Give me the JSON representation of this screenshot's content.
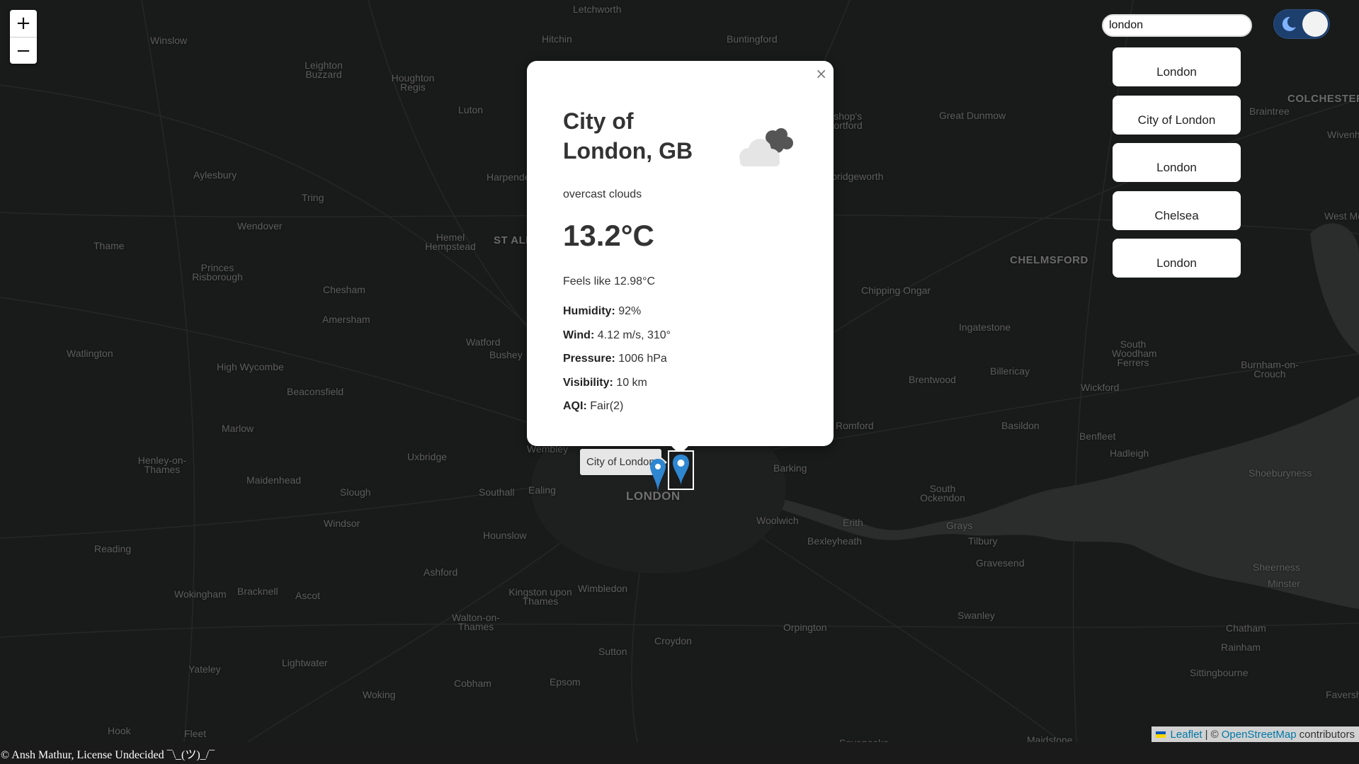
{
  "map": {
    "places": [
      {
        "name": "Letchworth"
      },
      {
        "name": "Winslow"
      },
      {
        "name": "Hitchin"
      },
      {
        "name": "Buntingford"
      },
      {
        "name": "Leighton Buzzard"
      },
      {
        "name": "Houghton Regis"
      },
      {
        "name": "Luton"
      },
      {
        "name": "Bishop's Stortford"
      },
      {
        "name": "Great Dunmow"
      },
      {
        "name": "Braintree"
      },
      {
        "name": "COLCHESTER"
      },
      {
        "name": "Aylesbury"
      },
      {
        "name": "Harpenden"
      },
      {
        "name": "Tring"
      },
      {
        "name": "Sawbridgeworth"
      },
      {
        "name": "Wendover"
      },
      {
        "name": "Hemel Hempstead"
      },
      {
        "name": "ST ALBANS"
      },
      {
        "name": "Thame"
      },
      {
        "name": "Princes Risborough"
      },
      {
        "name": "CHELMSFORD"
      },
      {
        "name": "Chesham"
      },
      {
        "name": "Chipping Ongar"
      },
      {
        "name": "Amersham"
      },
      {
        "name": "Watford"
      },
      {
        "name": "Bushey"
      },
      {
        "name": "Ingatestone"
      },
      {
        "name": "Watlington"
      },
      {
        "name": "High Wycombe"
      },
      {
        "name": "South Woodham Ferrers"
      },
      {
        "name": "Burnham-on-Crouch"
      },
      {
        "name": "Brentwood"
      },
      {
        "name": "Billericay"
      },
      {
        "name": "Wickford"
      },
      {
        "name": "Beaconsfield"
      },
      {
        "name": "Marlow"
      },
      {
        "name": "Romford"
      },
      {
        "name": "Basildon"
      },
      {
        "name": "Benfleet"
      },
      {
        "name": "Hadleigh"
      },
      {
        "name": "Henley-on-Thames"
      },
      {
        "name": "Uxbridge"
      },
      {
        "name": "Wembley"
      },
      {
        "name": "Barking"
      },
      {
        "name": "Shoeburyness"
      },
      {
        "name": "Maidenhead"
      },
      {
        "name": "Slough"
      },
      {
        "name": "Southall"
      },
      {
        "name": "Ealing"
      },
      {
        "name": "LONDON"
      },
      {
        "name": "South Ockendon"
      },
      {
        "name": "Windsor"
      },
      {
        "name": "Hounslow"
      },
      {
        "name": "Woolwich"
      },
      {
        "name": "Erith"
      },
      {
        "name": "Grays"
      },
      {
        "name": "Reading"
      },
      {
        "name": "Bexleyheath"
      },
      {
        "name": "Tilbury"
      },
      {
        "name": "Gravesend"
      },
      {
        "name": "Sheerness"
      },
      {
        "name": "Minster"
      },
      {
        "name": "Ashford"
      },
      {
        "name": "Wokingham"
      },
      {
        "name": "Bracknell"
      },
      {
        "name": "Ascot"
      },
      {
        "name": "Kingston upon Thames"
      },
      {
        "name": "Wimbledon"
      },
      {
        "name": "Walton-on-Thames"
      },
      {
        "name": "Orpington"
      },
      {
        "name": "Swanley"
      },
      {
        "name": "Chatham"
      },
      {
        "name": "Rainham"
      },
      {
        "name": "Sutton"
      },
      {
        "name": "Croydon"
      },
      {
        "name": "Yateley"
      },
      {
        "name": "Lightwater"
      },
      {
        "name": "Sittingbourne"
      },
      {
        "name": "Epsom"
      },
      {
        "name": "Cobham"
      },
      {
        "name": "Woking"
      },
      {
        "name": "Faversham"
      },
      {
        "name": "Hook"
      },
      {
        "name": "Fleet"
      },
      {
        "name": "Sevenoaks"
      },
      {
        "name": "Maidstone"
      },
      {
        "name": "West Mersea"
      },
      {
        "name": "Wivenhoe"
      }
    ]
  },
  "zoom": {
    "in_label": "+",
    "out_label": "−"
  },
  "search": {
    "value": "london"
  },
  "theme_toggle": {
    "mode": "dark",
    "icon": "moon-icon"
  },
  "suggestions": [
    "London",
    "City of London",
    "London",
    "Chelsea",
    "London"
  ],
  "popup": {
    "close_label": "×",
    "city": "City of London, GB",
    "icon": "overcast-clouds-icon",
    "description": "overcast clouds",
    "temperature": "13.2°C",
    "feels_like": "Feels like 12.98°C",
    "details": [
      {
        "label": "Humidity:",
        "value": "92%"
      },
      {
        "label": "Wind:",
        "value": "4.12 m/s, 310°"
      },
      {
        "label": "Pressure:",
        "value": "1006 hPa"
      },
      {
        "label": "Visibility:",
        "value": "10 km"
      },
      {
        "label": "AQI:",
        "value": "Fair(2)"
      }
    ]
  },
  "tooltip": {
    "text": "City of London"
  },
  "marker_color": "#2f86d1",
  "attribution": {
    "leaflet": "Leaflet",
    "separator": "| ©",
    "osm": "OpenStreetMap",
    "contributors": "contributors"
  },
  "footer": {
    "text": "© Ansh Mathur, License Undecided ¯\\_(ツ)_/¯"
  }
}
